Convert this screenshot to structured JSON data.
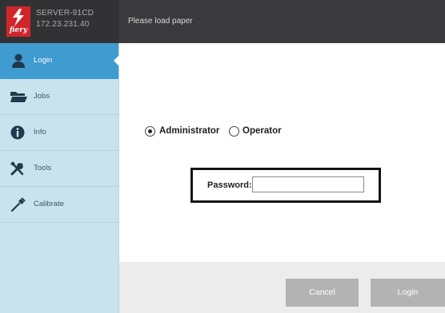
{
  "header": {
    "logo_text": "fiery",
    "server_name": "SERVER-91CD",
    "server_ip": "172.23.231.40",
    "status_message": "Please load paper"
  },
  "sidebar": {
    "items": [
      {
        "label": "Login",
        "icon": "user-icon",
        "active": true
      },
      {
        "label": "Jobs",
        "icon": "folder-icon",
        "active": false
      },
      {
        "label": "Info",
        "icon": "info-icon",
        "active": false
      },
      {
        "label": "Tools",
        "icon": "tools-icon",
        "active": false
      },
      {
        "label": "Calibrate",
        "icon": "calibrate-icon",
        "active": false
      }
    ]
  },
  "login": {
    "roles": [
      {
        "label": "Administrator",
        "selected": true
      },
      {
        "label": "Operator",
        "selected": false
      }
    ],
    "password_label": "Password:",
    "password_value": "",
    "cancel_label": "Cancel",
    "login_label": "Login"
  },
  "colors": {
    "header_bg": "#3a3a3c",
    "sidebar_bg": "#c9e3ee",
    "active_item": "#3f9bd0",
    "logo_red": "#d2252a",
    "button_bg": "#b3b3b3"
  }
}
